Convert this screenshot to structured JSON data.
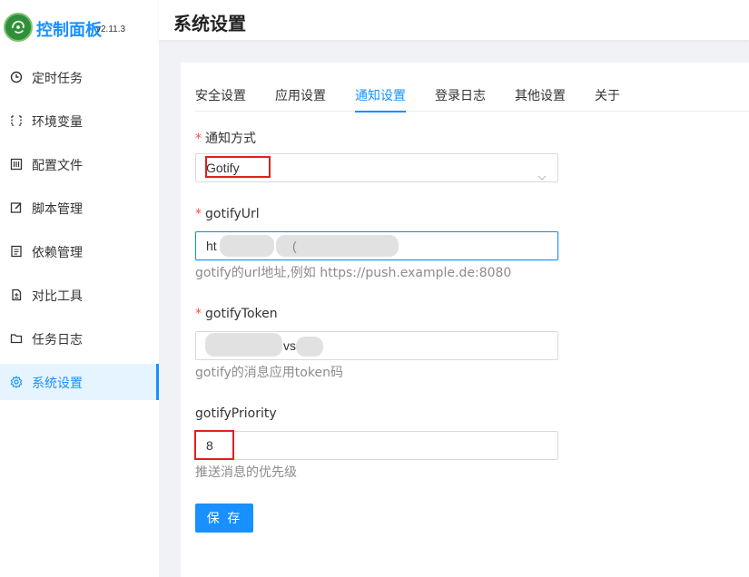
{
  "app": {
    "title": "控制面板",
    "version": "v2.11.3"
  },
  "sidebar": {
    "items": [
      {
        "label": "定时任务",
        "icon": "clock-icon"
      },
      {
        "label": "环境变量",
        "icon": "variable-icon"
      },
      {
        "label": "配置文件",
        "icon": "sliders-icon"
      },
      {
        "label": "脚本管理",
        "icon": "edit-icon"
      },
      {
        "label": "依赖管理",
        "icon": "package-icon"
      },
      {
        "label": "对比工具",
        "icon": "diff-icon"
      },
      {
        "label": "任务日志",
        "icon": "folder-icon"
      },
      {
        "label": "系统设置",
        "icon": "gear-icon",
        "active": true
      }
    ]
  },
  "header": {
    "title": "系统设置"
  },
  "tabs": [
    {
      "label": "安全设置"
    },
    {
      "label": "应用设置"
    },
    {
      "label": "通知设置",
      "active": true
    },
    {
      "label": "登录日志"
    },
    {
      "label": "其他设置"
    },
    {
      "label": "关于"
    }
  ],
  "form": {
    "notify_method": {
      "label": "通知方式",
      "required": true,
      "value": "Gotify"
    },
    "gotify_url": {
      "label": "gotifyUrl",
      "required": true,
      "value_prefix": "ht",
      "value_fragment": "(",
      "help": "gotify的url地址,例如 https://push.example.de:8080"
    },
    "gotify_token": {
      "label": "gotifyToken",
      "required": true,
      "value_fragment": "vs",
      "help": "gotify的消息应用token码"
    },
    "gotify_priority": {
      "label": "gotifyPriority",
      "required": false,
      "value": "8",
      "help": "推送消息的优先级"
    },
    "save_label": "保 存"
  },
  "colors": {
    "accent": "#1890ff",
    "required": "#ff4d4f",
    "annotation": "#e02020"
  }
}
